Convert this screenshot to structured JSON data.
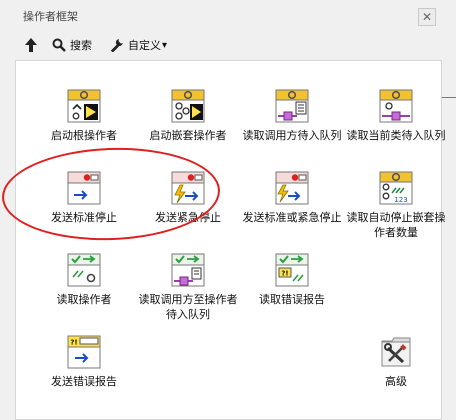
{
  "window": {
    "title": "操作者框架",
    "close_glyph": "✕"
  },
  "toolbar": {
    "up_icon": "up-arrow-icon",
    "search_label": "搜索",
    "customize_label": "自定义",
    "dropdown_glyph": "▾"
  },
  "items": [
    {
      "label": "启动根操作者",
      "icon": "launch-root-actor-icon"
    },
    {
      "label": "启动嵌套操作者",
      "icon": "launch-nested-actor-icon"
    },
    {
      "label": "读取调用方待入队列",
      "icon": "read-caller-enqueuer-icon"
    },
    {
      "label": "读取当前类待入队列",
      "icon": "read-self-enqueuer-icon"
    },
    {
      "label": "发送标准停止",
      "icon": "send-normal-stop-icon"
    },
    {
      "label": "发送紧急停止",
      "icon": "send-emergency-stop-icon"
    },
    {
      "label": "发送标准或紧急停止",
      "icon": "send-normal-or-emergency-stop-icon"
    },
    {
      "label": "读取自动停止嵌套操作者数量",
      "icon": "read-autostop-nested-count-icon"
    },
    {
      "label": "读取操作者",
      "icon": "read-actor-icon"
    },
    {
      "label": "读取调用方至操作者待入队列",
      "icon": "read-caller-to-actor-enqueuer-icon"
    },
    {
      "label": "读取错误报告",
      "icon": "read-error-report-icon"
    },
    {
      "label": "发送错误报告",
      "icon": "send-error-report-icon"
    },
    {
      "label": "高级",
      "icon": "advanced-folder-icon"
    }
  ],
  "icon_badges": {
    "count_badge": "123",
    "error_badge": "?!"
  },
  "colors": {
    "annotation": "#e02020",
    "icon_header": "#f2c230",
    "icon_green": "#2e9e3e"
  }
}
